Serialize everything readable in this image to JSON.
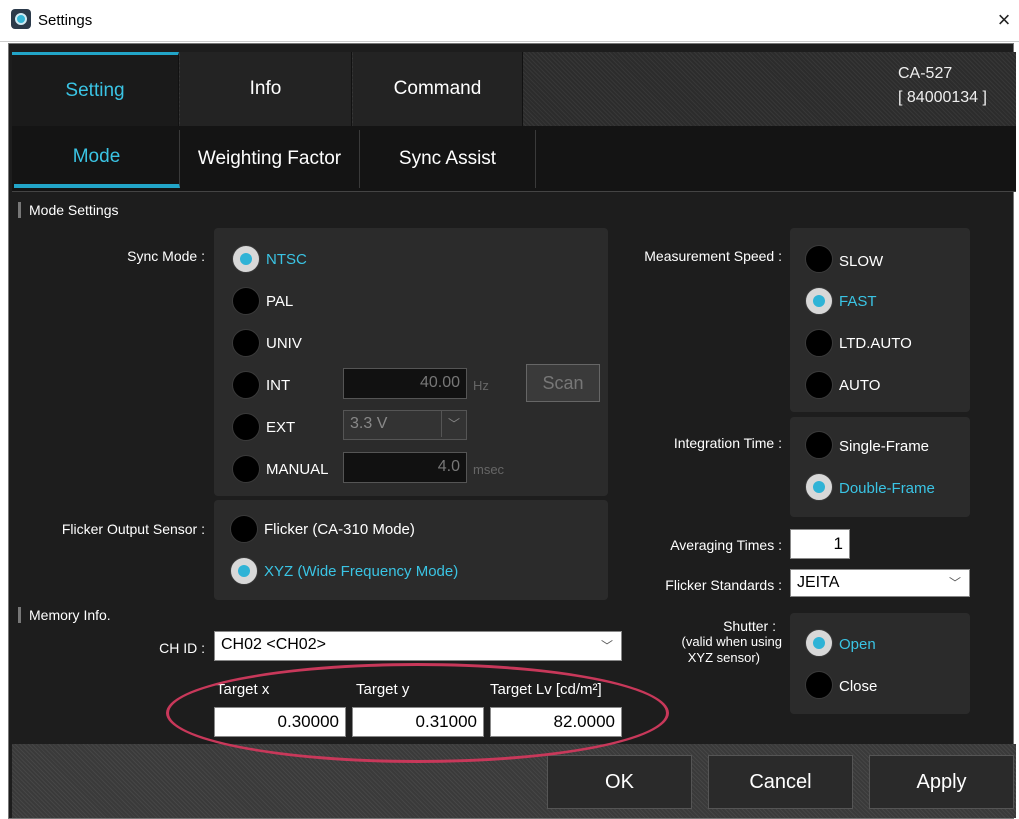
{
  "window": {
    "title": "Settings",
    "close": "×"
  },
  "tabs": [
    "Setting",
    "Info",
    "Command"
  ],
  "device": {
    "model": "CA-527",
    "serial": "[ 84000134 ]"
  },
  "subtabs": [
    "Mode",
    "Weighting Factor",
    "Sync Assist"
  ],
  "mode_settings": {
    "section_label": "Mode Settings",
    "sync_mode_label": "Sync Mode :",
    "sync_options": [
      "NTSC",
      "PAL",
      "UNIV",
      "INT",
      "EXT",
      "MANUAL"
    ],
    "sync_selected": "NTSC",
    "int_value": "40.00",
    "int_unit": "Hz",
    "scan_label": "Scan",
    "ext_value": "3.3 V",
    "manual_value": "4.0",
    "manual_unit": "msec",
    "flicker_sensor_label": "Flicker Output Sensor :",
    "flicker_options": [
      "Flicker (CA-310 Mode)",
      "XYZ (Wide Frequency Mode)"
    ],
    "flicker_selected": "XYZ (Wide Frequency Mode)",
    "speed_label": "Measurement Speed :",
    "speed_options": [
      "SLOW",
      "FAST",
      "LTD.AUTO",
      "AUTO"
    ],
    "speed_selected": "FAST",
    "integration_label": "Integration Time :",
    "integration_options": [
      "Single-Frame",
      "Double-Frame"
    ],
    "integration_selected": "Double-Frame",
    "averaging_label": "Averaging Times :",
    "averaging_value": "1",
    "flicker_std_label": "Flicker Standards :",
    "flicker_std_value": "JEITA",
    "shutter_label_1": "Shutter :",
    "shutter_label_2": "(valid when using",
    "shutter_label_3": "XYZ sensor)",
    "shutter_options": [
      "Open",
      "Close"
    ],
    "shutter_selected": "Open"
  },
  "memory": {
    "section_label": "Memory Info.",
    "ch_id_label": "CH ID :",
    "ch_id_value": "CH02 <CH02>",
    "target_x_label": "Target x",
    "target_y_label": "Target y",
    "target_lv_label": "Target Lv [cd/m²]",
    "target_x": "0.30000",
    "target_y": "0.31000",
    "target_lv": "82.0000"
  },
  "footer": {
    "ok": "OK",
    "cancel": "Cancel",
    "apply": "Apply"
  },
  "colors": {
    "accent": "#3ac4e4",
    "highlight_ellipse": "#c8385a"
  }
}
